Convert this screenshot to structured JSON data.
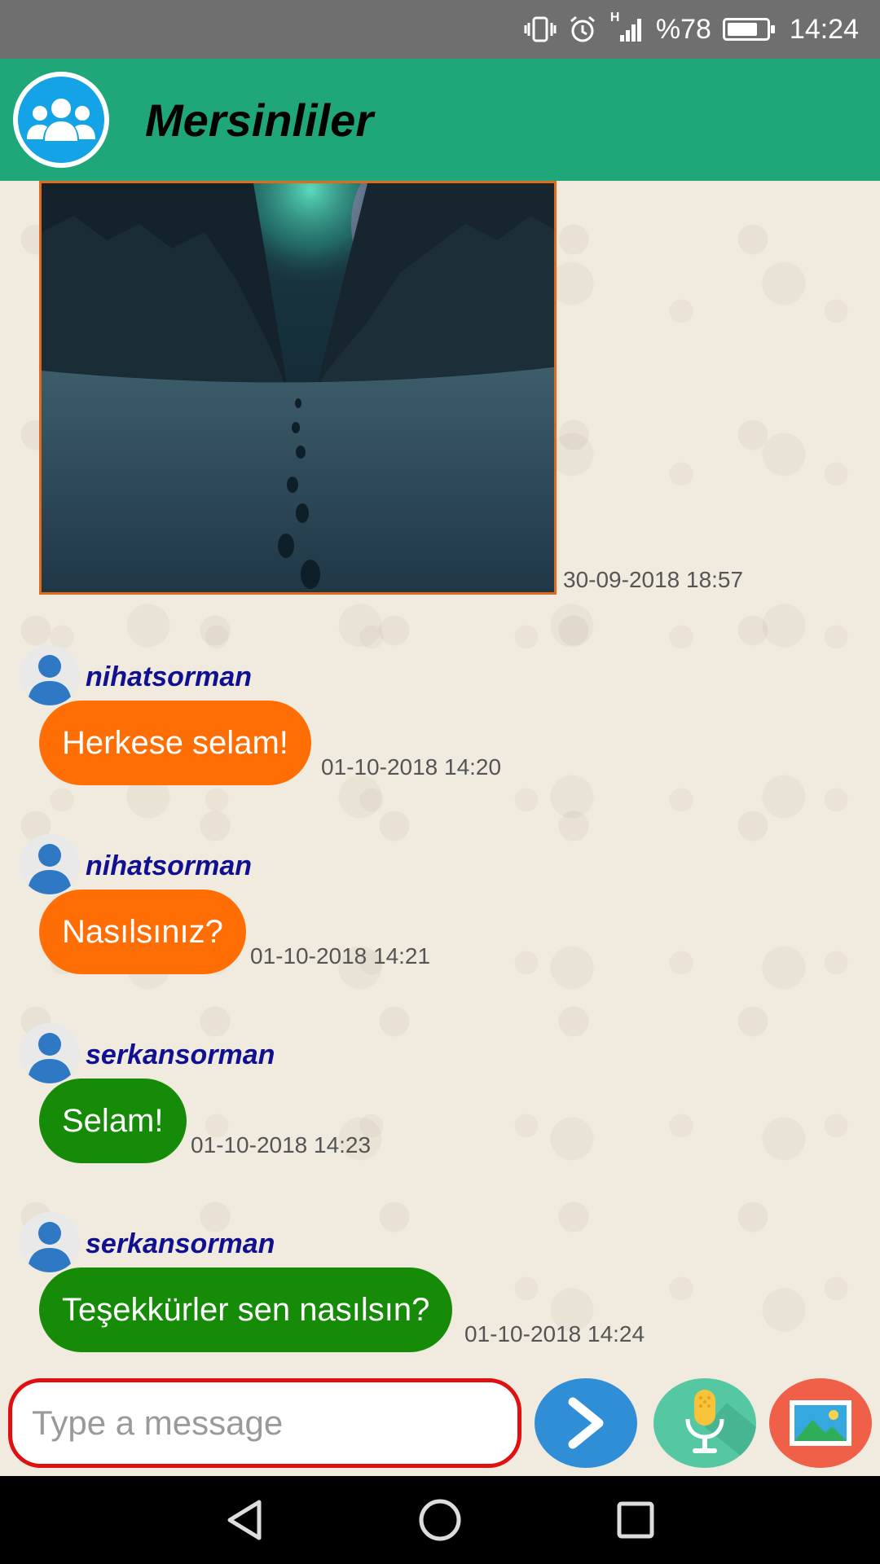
{
  "status_bar": {
    "network_label": "H",
    "battery": "%78",
    "battery_level": 0.78,
    "time": "14:24"
  },
  "header": {
    "title": "Mersinliler"
  },
  "photo_message": {
    "timestamp": "30-09-2018 18:57"
  },
  "messages": [
    {
      "sender": "nihatsorman",
      "text": "Herkese selam!",
      "time": "01-10-2018 14:20",
      "color": "#ff6e05"
    },
    {
      "sender": "nihatsorman",
      "text": "Nasılsınız?",
      "time": "01-10-2018 14:21",
      "color": "#ff6e05"
    },
    {
      "sender": "serkansorman",
      "text": "Selam!",
      "time": "01-10-2018 14:23",
      "color": "#168b08"
    },
    {
      "sender": "serkansorman",
      "text": "Teşekkürler sen nasılsın?",
      "time": "01-10-2018 14:24",
      "color": "#168b08"
    }
  ],
  "composer": {
    "placeholder": "Type a message",
    "send_icon": "chevron-right-icon",
    "mic_icon": "microphone-icon",
    "image_icon": "image-icon"
  },
  "colors": {
    "app_bar": "#1fa77a",
    "input_border": "#e01010",
    "sender_name": "#101090"
  }
}
